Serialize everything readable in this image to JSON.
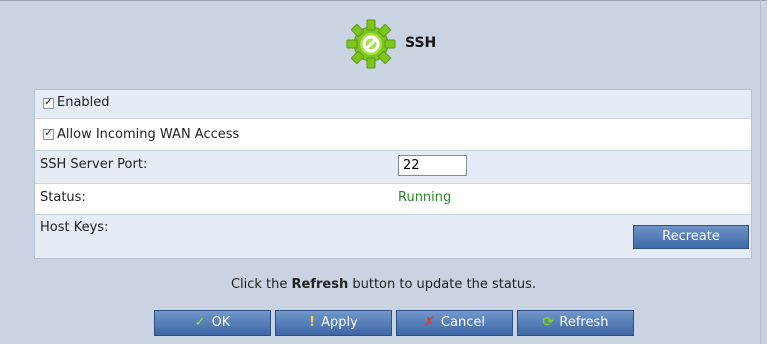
{
  "header": {
    "title": "SSH",
    "icon": "gear-icon",
    "accent": "#7ec61f"
  },
  "settings": {
    "enabled_label": "Enabled",
    "enabled_checked": true,
    "wan_access_label": "Allow Incoming WAN Access",
    "wan_access_checked": true,
    "port_label": "SSH Server Port:",
    "port_value": "22",
    "status_label": "Status:",
    "status_value": "Running",
    "status_color": "#2a8a2a",
    "host_keys_label": "Host Keys:",
    "recreate_label": "Recreate"
  },
  "footer": {
    "hint_before": "Click the ",
    "hint_bold": "Refresh",
    "hint_after": " button to update the status.",
    "buttons": [
      {
        "label": "OK",
        "icon": "checkmark-icon"
      },
      {
        "label": "Apply",
        "icon": "exclamation-icon"
      },
      {
        "label": "Cancel",
        "icon": "x-icon"
      },
      {
        "label": "Refresh",
        "icon": "refresh-icon"
      }
    ]
  }
}
